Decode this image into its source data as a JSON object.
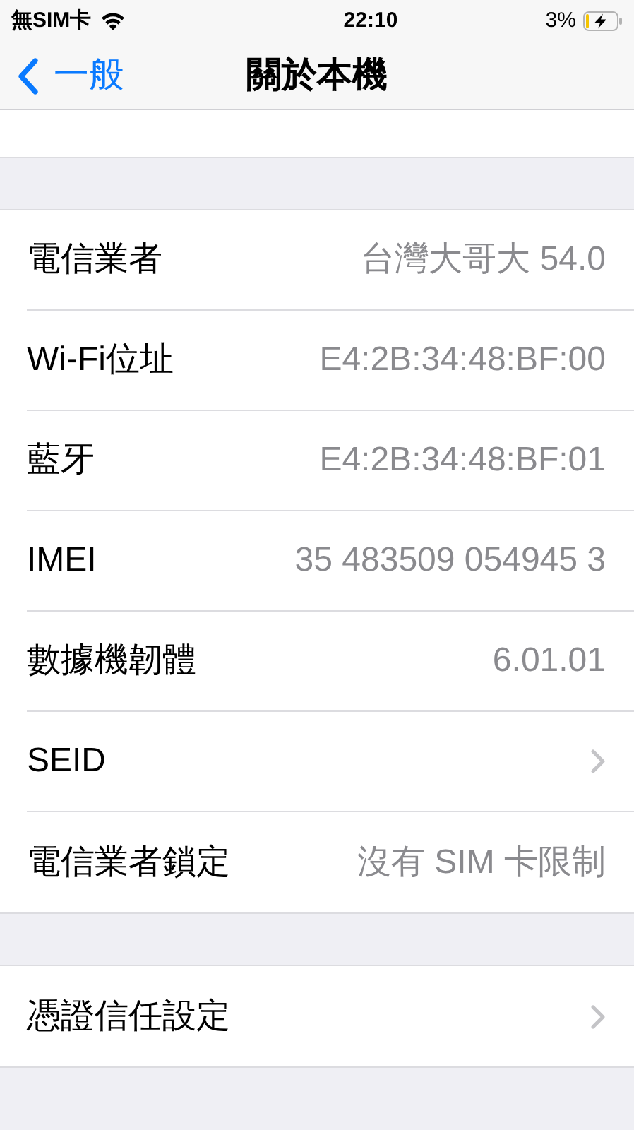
{
  "status_bar": {
    "carrier": "無SIM卡",
    "time": "22:10",
    "battery": "3%"
  },
  "nav": {
    "back": "一般",
    "title": "關於本機"
  },
  "groups": [
    {
      "rows": [
        {
          "kind": "value",
          "label": "電信業者",
          "value": "台灣大哥大 54.0"
        },
        {
          "kind": "value",
          "label": "Wi-Fi位址",
          "value": "E4:2B:34:48:BF:00"
        },
        {
          "kind": "value",
          "label": "藍牙",
          "value": "E4:2B:34:48:BF:01"
        },
        {
          "kind": "value",
          "label": "IMEI",
          "value": "35 483509 054945 3"
        },
        {
          "kind": "value",
          "label": "數據機韌體",
          "value": "6.01.01"
        },
        {
          "kind": "link",
          "label": "SEID"
        },
        {
          "kind": "value",
          "label": "電信業者鎖定",
          "value": "沒有 SIM 卡限制"
        }
      ]
    },
    {
      "rows": [
        {
          "kind": "link",
          "label": "憑證信任設定"
        }
      ]
    }
  ]
}
